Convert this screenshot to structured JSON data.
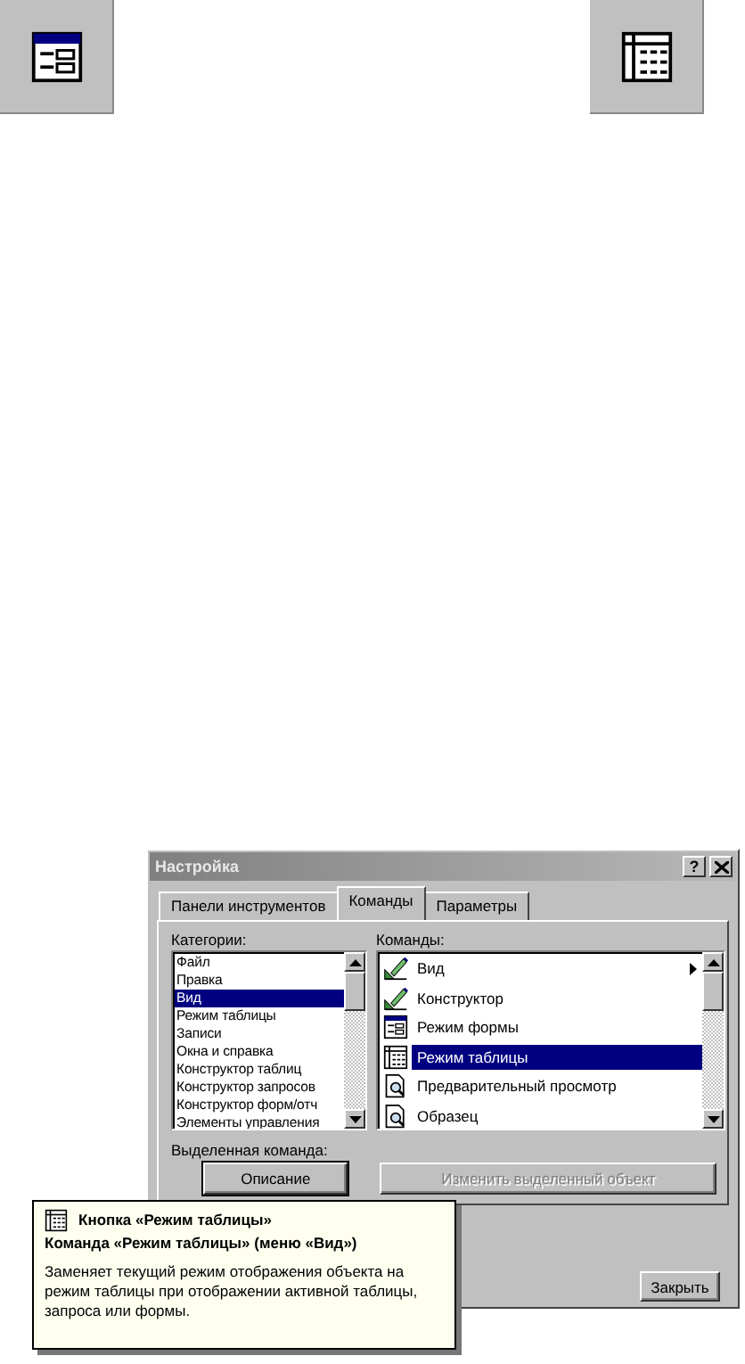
{
  "toolbar_buttons": [
    {
      "kind": "form"
    },
    {
      "kind": "datasheet"
    }
  ],
  "dialog": {
    "title": "Настройка",
    "help_button": "?",
    "tabs": [
      {
        "label": "Панели инструментов",
        "selected": false
      },
      {
        "label": "Команды",
        "selected": true
      },
      {
        "label": "Параметры",
        "selected": false
      }
    ],
    "categories_label": "Категории:",
    "categories": [
      {
        "label": "Файл",
        "selected": false
      },
      {
        "label": "Правка",
        "selected": false
      },
      {
        "label": "Вид",
        "selected": true
      },
      {
        "label": "Режим таблицы",
        "selected": false
      },
      {
        "label": "Записи",
        "selected": false
      },
      {
        "label": "Окна и справка",
        "selected": false
      },
      {
        "label": "Конструктор таблиц",
        "selected": false
      },
      {
        "label": "Конструктор запросов",
        "selected": false
      },
      {
        "label": "Конструктор форм/отч",
        "selected": false
      },
      {
        "label": "Элементы управления",
        "selected": false
      }
    ],
    "commands_label": "Команды:",
    "commands": [
      {
        "label": "Вид",
        "kind": "design",
        "selected": false,
        "submenu": true
      },
      {
        "label": "Конструктор",
        "kind": "design",
        "selected": false,
        "submenu": false
      },
      {
        "label": "Режим формы",
        "kind": "form",
        "selected": false,
        "submenu": false
      },
      {
        "label": "Режим таблицы",
        "kind": "datasheet",
        "selected": true,
        "submenu": false
      },
      {
        "label": "Предварительный просмотр",
        "kind": "preview",
        "selected": false,
        "submenu": false
      },
      {
        "label": "Образец",
        "kind": "preview",
        "selected": false,
        "submenu": false
      }
    ],
    "selected_command_label": "Выделенная команда:",
    "description_button": "Описание",
    "modify_button": {
      "label": "Изменить выделенный объект",
      "disabled": true
    },
    "close_button": "Закрыть"
  },
  "tooltip": {
    "kind": "datasheet",
    "title": "Кнопка «Режим таблицы»",
    "subtitle": "Команда «Режим таблицы» (меню «Вид»)",
    "text": "Заменяет текущий режим отображения объекта на режим таблицы при отображении активной таблицы, запроса или формы."
  }
}
